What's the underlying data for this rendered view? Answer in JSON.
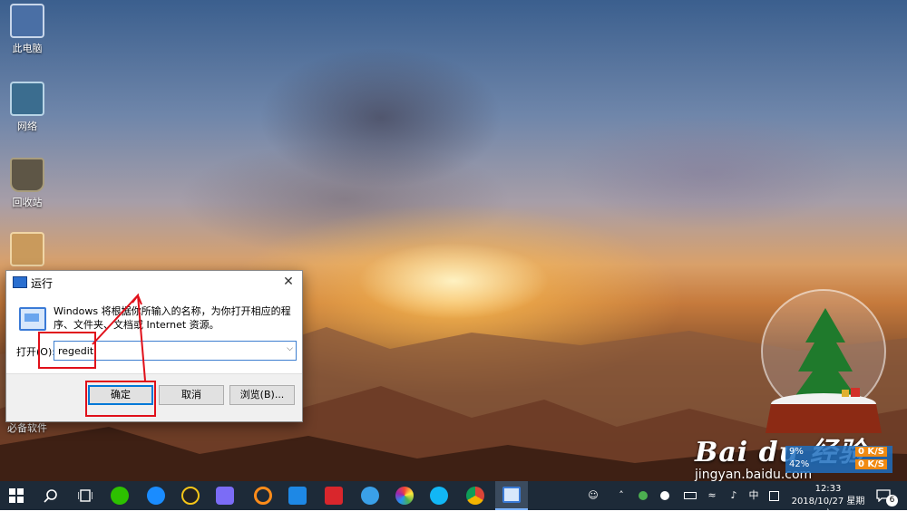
{
  "desktop": {
    "icons": [
      {
        "label": "此电脑",
        "icon": "computer-icon"
      },
      {
        "label": "网络",
        "icon": "network-icon"
      },
      {
        "label": "回收站",
        "icon": "recycle-bin-icon"
      },
      {
        "label": "",
        "icon": "folder-icon"
      },
      {
        "label": "必备软件",
        "icon": "software-icon"
      }
    ]
  },
  "run_dialog": {
    "title": "运行",
    "description": "Windows 将根据你所输入的名称，为你打开相应的程序、文件夹、文档或 Internet 资源。",
    "open_label": "打开(O):",
    "input_value": "regedit",
    "ok_label": "确定",
    "cancel_label": "取消",
    "browse_label": "浏览(B)..."
  },
  "watermark": {
    "brand": "Bai du 经验",
    "site": "jingyan.baidu.com"
  },
  "net_meter": {
    "row1_percent": "9%",
    "row1_speed": "0 K/S",
    "row2_percent": "42%",
    "row2_speed": "0 K/S"
  },
  "taskbar": {
    "apps": [
      "start-icon",
      "search-icon",
      "task-view-icon",
      "wechat-icon",
      "kugou-icon",
      "qq-icon",
      "feishu-icon",
      "app-arc-icon",
      "app-blue-icon",
      "app-red-icon",
      "ie-icon",
      "app-colorful-icon",
      "qq-browser-icon",
      "chrome-icon",
      "run-icon"
    ],
    "tray": {
      "ime_label": "中"
    },
    "clock": {
      "time": "12:33",
      "date": "2018/10/27 星期六"
    },
    "notification_count": "6"
  },
  "colors": {
    "taskbar": "#1d2a38",
    "annotation": "#e0101a",
    "dialog_accent": "#0078d7",
    "net_meter_bg": "#1e6ebe",
    "net_meter_speed": "#f08a12"
  }
}
